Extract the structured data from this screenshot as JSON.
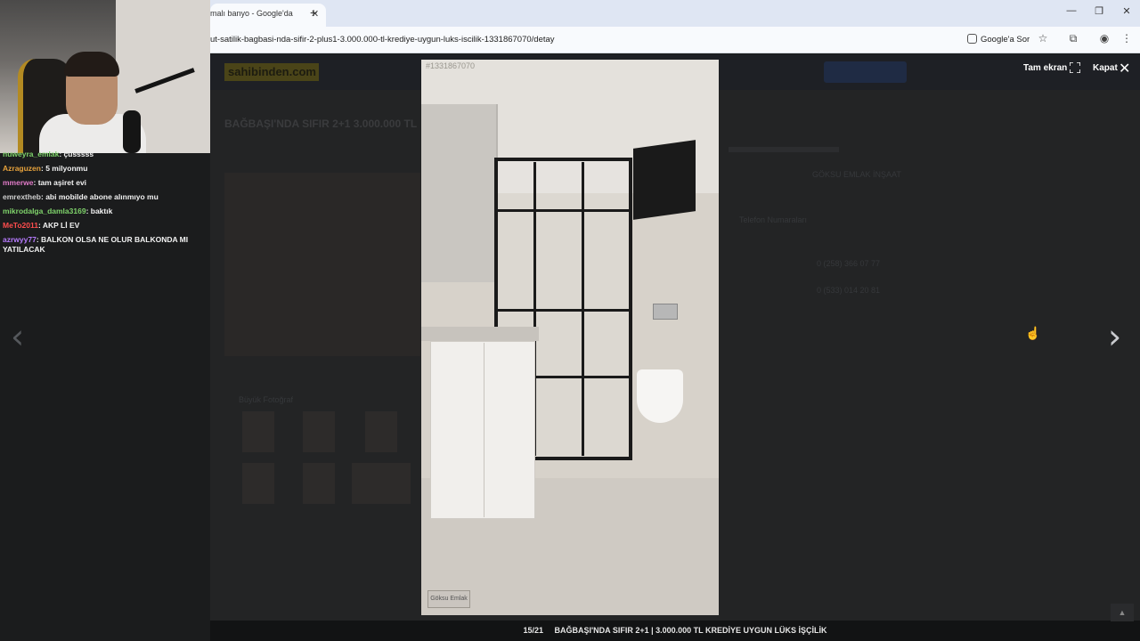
{
  "browser": {
    "tab_title": "malı banyo - Google'da",
    "tab_close": "✕",
    "new_tab": "+",
    "window_controls": [
      "—",
      "❐",
      "✕"
    ],
    "url": "ut-satilik-bagbasi-nda-sifir-2-plus1-3.000.000-tl-krediye-uygun-luks-iscilik-1331867070/detay",
    "google_sor": "Google'a Sor"
  },
  "chat": {
    "messages": [
      {
        "user": "nuweyra_emlak",
        "text": "çusssss",
        "color": "#7fd36b"
      },
      {
        "user": "Azraguzen",
        "text": "5 milyonmu",
        "color": "#e6a23c"
      },
      {
        "user": "mmerwe",
        "text": "tam aşiret evi",
        "color": "#e07bc8"
      },
      {
        "user": "emrextheb",
        "text": "abi mobilde abone alınmıyo mu",
        "color": "#cfcfcf"
      },
      {
        "user": "mikrodalga_damla3169",
        "text": "baktık",
        "color": "#7fd36b"
      },
      {
        "user": "MeTo2011",
        "text": "AKP Lİ EV",
        "color": "#ff4d4d"
      },
      {
        "user": "azrwyy77",
        "text": "BALKON OLSA NE OLUR BALKONDA MI YATILACAK",
        "color": "#b77bff"
      }
    ]
  },
  "page_bg": {
    "logo": "sahibinden.com",
    "title": "BAĞBAŞI'NDA SIFIR 2+1 3.000.000 TL",
    "phone1": "0 (258) 366 07 77",
    "phone2": "0 (533) 014 20 81",
    "contact_label": "Telefon Numaraları",
    "office": "GÖKSU EMLAK İNŞAAT",
    "big_photo_label": "Büyük Fotoğraf"
  },
  "lightbox": {
    "photo_id": "#1331867070",
    "fullscreen_label": "Tam ekran",
    "close_label": "Kapat",
    "counter": "15/21",
    "caption": "BAĞBAŞI'NDA SIFIR 2+1 | 3.000.000 TL KREDİYE UYGUN LÜKS İŞÇİLİK",
    "watermark": "Göksu Emlak"
  }
}
